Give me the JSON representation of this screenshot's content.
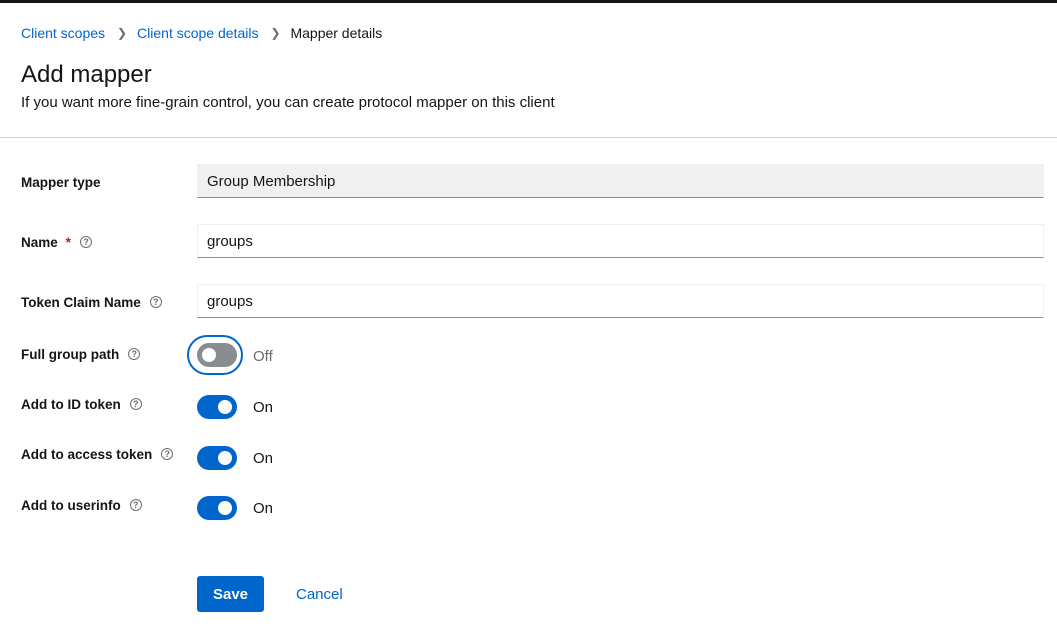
{
  "breadcrumb": {
    "items": [
      "Client scopes",
      "Client scope details"
    ],
    "current": "Mapper details"
  },
  "header": {
    "title": "Add mapper",
    "subtitle": "If you want more fine-grain control, you can create protocol mapper on this client"
  },
  "form": {
    "mapper_type": {
      "label": "Mapper type",
      "value": "Group Membership"
    },
    "name": {
      "label": "Name",
      "required_mark": "*",
      "value": "groups"
    },
    "token_claim_name": {
      "label": "Token Claim Name",
      "value": "groups"
    },
    "full_group_path": {
      "label": "Full group path",
      "state": "Off",
      "checked": false
    },
    "add_to_id_token": {
      "label": "Add to ID token",
      "state": "On",
      "checked": true
    },
    "add_to_access_token": {
      "label": "Add to access token",
      "state": "On",
      "checked": true
    },
    "add_to_userinfo": {
      "label": "Add to userinfo",
      "state": "On",
      "checked": true
    }
  },
  "actions": {
    "save": "Save",
    "cancel": "Cancel"
  },
  "icons": {
    "help": "help-circle-icon",
    "separator": "chevron-right-icon"
  },
  "colors": {
    "accent": "#0066cc",
    "required": "#c9190b",
    "toggle_off": "#8a8d90"
  }
}
